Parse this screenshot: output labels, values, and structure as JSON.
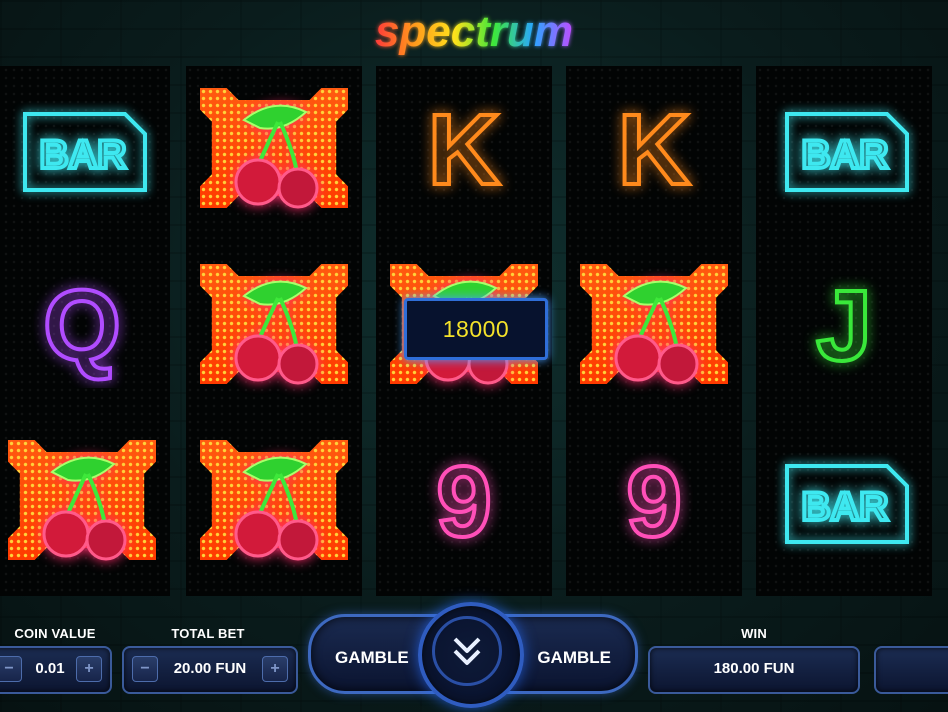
{
  "game": {
    "title": "spectrum"
  },
  "reels": [
    [
      "bar",
      "q",
      "cherry-win"
    ],
    [
      "cherry-win",
      "cherry-win",
      "cherry-win"
    ],
    [
      "k",
      "cherry-win",
      "9"
    ],
    [
      "k",
      "cherry-win",
      "9"
    ],
    [
      "bar",
      "j",
      "bar"
    ]
  ],
  "symbols": {
    "bar": {
      "text": "BAR",
      "color": "#3ee8f0"
    },
    "q": {
      "text": "Q",
      "color": "#b04cff"
    },
    "k": {
      "text": "K",
      "color": "#ff8a1c"
    },
    "j": {
      "text": "J",
      "color": "#39e83a"
    },
    "9": {
      "text": "9",
      "color": "#ff4fb8"
    },
    "cherry-win": {
      "icon": "cherry-icon",
      "color": "#ff2a4a"
    }
  },
  "win_popup": {
    "amount": "18000"
  },
  "controls": {
    "coin_value": {
      "label": "COIN VALUE",
      "value": "0.01",
      "minus": "−",
      "plus": "+"
    },
    "total_bet": {
      "label": "TOTAL BET",
      "value": "20.00 FUN",
      "minus": "−",
      "plus": "+"
    },
    "gamble_left": "GAMBLE",
    "gamble_right": "GAMBLE",
    "spin_icon": "double-chevron-down-icon",
    "win": {
      "label": "WIN",
      "value": "180.00 FUN"
    }
  },
  "colors": {
    "accent": "#2f5cc0",
    "win_text": "#f4e22a"
  }
}
